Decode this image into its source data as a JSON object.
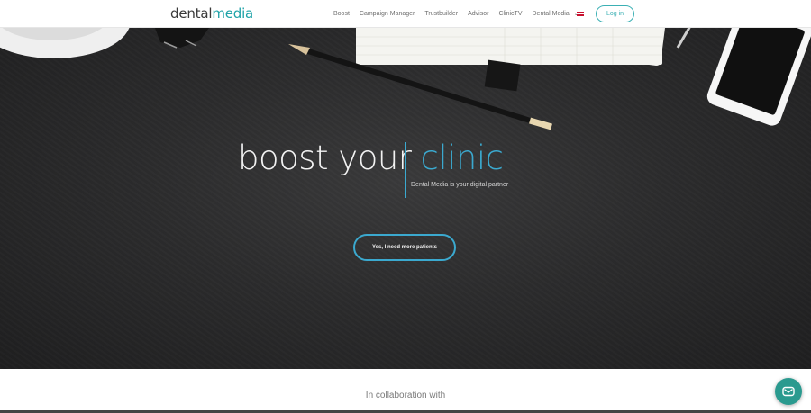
{
  "logo": {
    "part1": "dental",
    "part2": "media"
  },
  "nav": {
    "items": [
      "Boost",
      "Campaign Manager",
      "Trustbuilder",
      "Advisor",
      "ClinicTV",
      "Dental Media"
    ],
    "language_flag": "danish-flag-icon",
    "login_label": "Log in"
  },
  "hero": {
    "title_main": "boost your",
    "title_accent": "clinic",
    "subtitle": "Dental Media is your digital partner",
    "cta_label": "Yes, I need more patients"
  },
  "collab": {
    "text": "In collaboration with"
  },
  "chat": {
    "icon": "mail-icon"
  },
  "colors": {
    "accent_teal": "#1fa3a8",
    "accent_blue": "#3ba9cf",
    "hero_bg": "#2c2c2d",
    "chat_bg": "#2a9a8f"
  }
}
